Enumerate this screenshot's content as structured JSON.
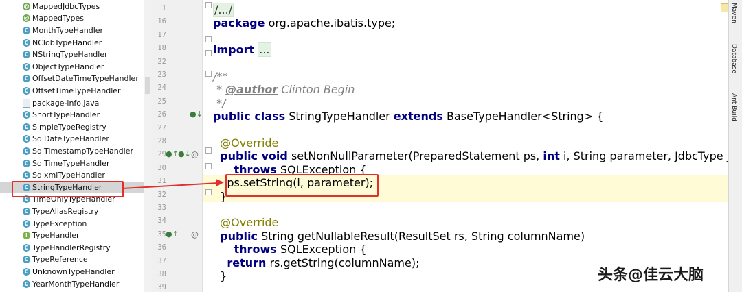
{
  "project_tree": {
    "items": [
      {
        "label": "MappedJdbcTypes",
        "icon": "annotation-icon",
        "kind": "enum"
      },
      {
        "label": "MappedTypes",
        "icon": "annotation-icon",
        "kind": "enum"
      },
      {
        "label": "MonthTypeHandler",
        "icon": "class-icon",
        "kind": "class"
      },
      {
        "label": "NClobTypeHandler",
        "icon": "class-icon",
        "kind": "class"
      },
      {
        "label": "NStringTypeHandler",
        "icon": "class-icon",
        "kind": "class"
      },
      {
        "label": "ObjectTypeHandler",
        "icon": "class-icon",
        "kind": "class"
      },
      {
        "label": "OffsetDateTimeTypeHandler",
        "icon": "class-icon",
        "kind": "class"
      },
      {
        "label": "OffsetTimeTypeHandler",
        "icon": "class-icon",
        "kind": "class"
      },
      {
        "label": "package-info.java",
        "icon": "java-file-icon",
        "kind": "file"
      },
      {
        "label": "ShortTypeHandler",
        "icon": "class-icon",
        "kind": "class"
      },
      {
        "label": "SimpleTypeRegistry",
        "icon": "class-icon",
        "kind": "class"
      },
      {
        "label": "SqlDateTypeHandler",
        "icon": "class-icon",
        "kind": "class"
      },
      {
        "label": "SqlTimestampTypeHandler",
        "icon": "class-icon",
        "kind": "class"
      },
      {
        "label": "SqlTimeTypeHandler",
        "icon": "class-icon",
        "kind": "class"
      },
      {
        "label": "SqlxmlTypeHandler",
        "icon": "class-icon",
        "kind": "class"
      },
      {
        "label": "StringTypeHandler",
        "icon": "class-icon",
        "kind": "class",
        "selected": true
      },
      {
        "label": "TimeOnlyTypeHandler",
        "icon": "class-icon",
        "kind": "class"
      },
      {
        "label": "TypeAliasRegistry",
        "icon": "class-icon",
        "kind": "class"
      },
      {
        "label": "TypeException",
        "icon": "class-icon",
        "kind": "class"
      },
      {
        "label": "TypeHandler",
        "icon": "interface-icon",
        "kind": "iface"
      },
      {
        "label": "TypeHandlerRegistry",
        "icon": "class-icon",
        "kind": "class"
      },
      {
        "label": "TypeReference",
        "icon": "abstract-class-icon",
        "kind": "class"
      },
      {
        "label": "UnknownTypeHandler",
        "icon": "class-icon",
        "kind": "class"
      },
      {
        "label": "YearMonthTypeHandler",
        "icon": "class-icon",
        "kind": "class"
      }
    ]
  },
  "editor": {
    "lines": [
      {
        "num": "1",
        "tokens": [
          {
            "t": "/.../",
            "c": "fold-box"
          }
        ]
      },
      {
        "num": "16",
        "tokens": [
          {
            "t": "package",
            "c": "kw"
          },
          {
            "t": " org.apache.ibatis.type;"
          }
        ]
      },
      {
        "num": "17",
        "tokens": []
      },
      {
        "num": "18",
        "tokens": [
          {
            "t": "import",
            "c": "kw"
          },
          {
            "t": " "
          },
          {
            "t": "...",
            "c": "fold-box"
          }
        ]
      },
      {
        "num": "22",
        "tokens": []
      },
      {
        "num": "23",
        "tokens": [
          {
            "t": "/**",
            "c": "cm"
          }
        ]
      },
      {
        "num": "24",
        "tokens": [
          {
            "t": " * ",
            "c": "cm"
          },
          {
            "t": "@author",
            "c": "cm bold"
          },
          {
            "t": " Clinton Begin",
            "c": "cm"
          }
        ]
      },
      {
        "num": "25",
        "tokens": [
          {
            "t": " */",
            "c": "cm"
          }
        ]
      },
      {
        "num": "26",
        "tokens": [
          {
            "t": "public class",
            "c": "kw"
          },
          {
            "t": " StringTypeHandler "
          },
          {
            "t": "extends",
            "c": "kw"
          },
          {
            "t": " BaseTypeHandler<String> {"
          }
        ]
      },
      {
        "num": "27",
        "tokens": []
      },
      {
        "num": "28",
        "tokens": [
          {
            "t": "  @Override",
            "c": "an"
          }
        ]
      },
      {
        "num": "29",
        "tokens": [
          {
            "t": "  "
          },
          {
            "t": "public void",
            "c": "kw"
          },
          {
            "t": " setNonNullParameter(PreparedStatement ps, "
          },
          {
            "t": "int",
            "c": "kw"
          },
          {
            "t": " i, String parameter, JdbcType jdbcType)"
          }
        ]
      },
      {
        "num": "30",
        "tokens": [
          {
            "t": "      "
          },
          {
            "t": "throws",
            "c": "kw"
          },
          {
            "t": " SQLException {"
          }
        ]
      },
      {
        "num": "31",
        "tokens": [
          {
            "t": "    ps.setString(i, parameter);"
          }
        ]
      },
      {
        "num": "32",
        "tokens": [
          {
            "t": "  }"
          }
        ]
      },
      {
        "num": "33",
        "tokens": []
      },
      {
        "num": "34",
        "tokens": [
          {
            "t": "  @Override",
            "c": "an"
          }
        ]
      },
      {
        "num": "35",
        "tokens": [
          {
            "t": "  "
          },
          {
            "t": "public",
            "c": "kw"
          },
          {
            "t": " String getNullableResult(ResultSet rs, String columnName)"
          }
        ]
      },
      {
        "num": "36",
        "tokens": [
          {
            "t": "      "
          },
          {
            "t": "throws",
            "c": "kw"
          },
          {
            "t": " SQLException {"
          }
        ]
      },
      {
        "num": "37",
        "tokens": [
          {
            "t": "    "
          },
          {
            "t": "return",
            "c": "kw"
          },
          {
            "t": " rs.getString(columnName);"
          }
        ]
      },
      {
        "num": "38",
        "tokens": [
          {
            "t": "  }"
          }
        ]
      },
      {
        "num": "39",
        "tokens": []
      }
    ]
  },
  "tool_windows": {
    "maven": "Maven",
    "database": "Database",
    "ant_build": "Ant Build"
  },
  "watermark": {
    "text": "头条@佳云大脑"
  },
  "colors": {
    "annotation_red": "#e0302c",
    "keyword": "#000080",
    "comment": "#808080",
    "selection": "#d5d5d5"
  }
}
